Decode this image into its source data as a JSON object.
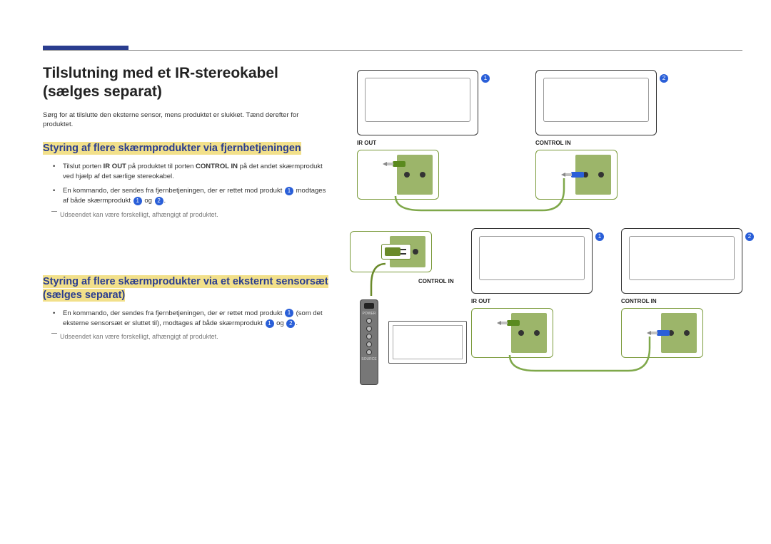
{
  "title": "Tilslutning med et IR-stereokabel (sælges separat)",
  "intro": "Sørg for at tilslutte den eksterne sensor, mens produktet er slukket. Tænd derefter for produktet.",
  "section1": {
    "heading": "Styring af flere skærmprodukter via fjernbetjeningen",
    "bullet1_pre": "Tilslut porten ",
    "bullet1_b1": "IR OUT",
    "bullet1_mid": " på produktet til porten ",
    "bullet1_b2": "CONTROL IN",
    "bullet1_post": " på det andet skærmprodukt ved hjælp af det særlige stereokabel.",
    "bullet2_pre": "En kommando, der sendes fra fjernbetjeningen, der er rettet mod produkt ",
    "bullet2_mid": " modtages af både skærmprodukt ",
    "bullet2_og": " og ",
    "bullet2_end": ".",
    "note": "Udseendet kan være forskelligt, afhængigt af produktet."
  },
  "section2": {
    "heading": "Styring af flere skærmprodukter via et eksternt sensorsæt (sælges separat)",
    "bullet1_pre": "En kommando, der sendes fra fjernbetjeningen, der er rettet mod produkt ",
    "bullet1_mid": " (som det eksterne sensorsæt er sluttet til), modtages af både skærmprodukt ",
    "bullet1_og": " og ",
    "bullet1_end": ".",
    "note": "Udseendet kan være forskelligt, afhængigt af produktet."
  },
  "labels": {
    "ir_out": "IR OUT",
    "control_in": "CONTROL IN",
    "n1": "1",
    "n2": "2",
    "remote_power": "POWER",
    "remote_source": "SOURCE"
  }
}
